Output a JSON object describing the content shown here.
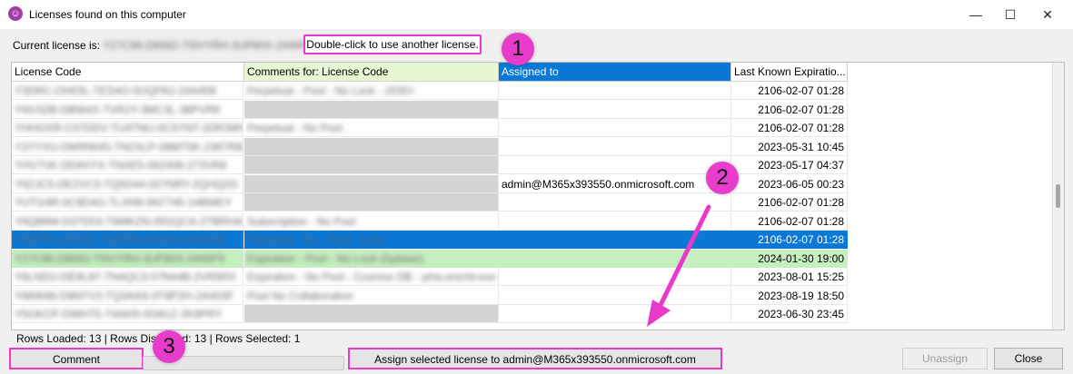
{
  "window": {
    "title": "Licenses found on this computer",
    "minimize": "—",
    "maximize": "☐",
    "close": "✕"
  },
  "current": {
    "label": "Current license is:",
    "code": "Y27C96-D8582-T5IVYRH-3UP80X-2440F9",
    "dash": "-",
    "hint": "Double-click to use another license."
  },
  "badges": [
    "1",
    "2",
    "3"
  ],
  "table": {
    "columns": [
      "License Code",
      "Comments for: License Code",
      "Assigned to",
      "Last Known Expiratio..."
    ],
    "rows": [
      {
        "code": "Y3DRC-OH03L-TES4O-0UQPA2-24A408",
        "comment": "Perpetual - Pool - No Lock - 2030+",
        "assigned": "",
        "date": "2106-02-07 01:28",
        "comment_gray": false,
        "style": "normal"
      },
      {
        "code": "YNV3ZB-DBW4X-TVR2Y-3MC3L-38PVRK",
        "comment": "",
        "assigned": "",
        "date": "2106-02-07 01:28",
        "comment_gray": true,
        "style": "normal"
      },
      {
        "code": "YHHGXR-C07DDV-TU4TNU-0C5YNT-2DR3WV",
        "comment": "Perpetual - No Pool",
        "assigned": "",
        "date": "2106-02-07 01:28",
        "comment_gray": false,
        "style": "normal"
      },
      {
        "code": "Y2YYXU-DWRW4S-TN2XLP-08MT5K-2367RB",
        "comment": "",
        "assigned": "",
        "date": "2023-05-31 10:45",
        "comment_gray": true,
        "style": "normal"
      },
      {
        "code": "YHV7VK-DD4XYX-TNXE5-062408-273VR8",
        "comment": "",
        "assigned": "",
        "date": "2023-05-17 04:37",
        "comment_gray": true,
        "style": "normal"
      },
      {
        "code": "Y6ZJC5-DE2VC3-TQ5D44-0Z7NRY-2QHQ2G",
        "comment": "",
        "assigned": "admin@M365x393550.onmicrosoft.com",
        "date": "2023-06-05 00:23",
        "comment_gray": true,
        "style": "normal"
      },
      {
        "code": "YUTG4R-0C9D4G-TLXN9-0N7745-14BWEY",
        "comment": "",
        "assigned": "",
        "date": "2106-02-07 01:28",
        "comment_gray": true,
        "style": "normal"
      },
      {
        "code": "Y6QB6M-D37D03-T6MKZN-05SQCA-2TBRHA",
        "comment": "Subscription - No Pool",
        "assigned": "",
        "date": "2106-02-07 01:28",
        "comment_gray": false,
        "style": "normal"
      },
      {
        "code": "Y5QPKY-DF9CE-TQ6Z04-0X8C6-2UUCNN",
        "comment": "Perpetual - A/L - Pool - Lock",
        "assigned": "",
        "date": "2106-02-07 01:28",
        "comment_gray": false,
        "style": "selected"
      },
      {
        "code": "Y27C96-D8582-T5IVYRH-3UP80X-2440F9",
        "comment": "Expiration - Pool - No Lock (Sybase)",
        "assigned": "",
        "date": "2024-01-30 19:00",
        "comment_gray": false,
        "style": "current"
      },
      {
        "code": "Y6LNDU-DE8L87-TN4QC3-07N44B-2VR5RX",
        "comment": "Expiration - No Pool - Cosmos DB - ytria-enicht-exe",
        "assigned": "",
        "date": "2023-08-01 15:25",
        "comment_gray": false,
        "style": "normal"
      },
      {
        "code": "Y66W46-D9NTV3-TQ3AAS-0T9P2H-2A403F",
        "comment": "Pool No Collaboration",
        "assigned": "",
        "date": "2023-08-19 18:50",
        "comment_gray": false,
        "style": "normal"
      },
      {
        "code": "Y5GKCP-DWHT5-T4AKR-0G81Z-2K9PRY",
        "comment": "",
        "assigned": "",
        "date": "2023-06-30 23:45",
        "comment_gray": true,
        "style": "normal"
      }
    ]
  },
  "status": {
    "text": "Rows Loaded: 13 | Rows Displayed: 13 | Rows Selected: 1"
  },
  "buttons": {
    "comment": "Comment",
    "assign": "Assign selected license to admin@M365x393550.onmicrosoft.com",
    "unassign": "Unassign",
    "close": "Close"
  },
  "colors": {
    "selected_bg": "#0b78d6",
    "current_bg": "#c6efc0",
    "comment_header_bg": "#e6f7d3",
    "assigned_header_bg": "#0b78d6",
    "empty_comment_bg": "#d4d4d4",
    "annotation": "#e839c8"
  }
}
